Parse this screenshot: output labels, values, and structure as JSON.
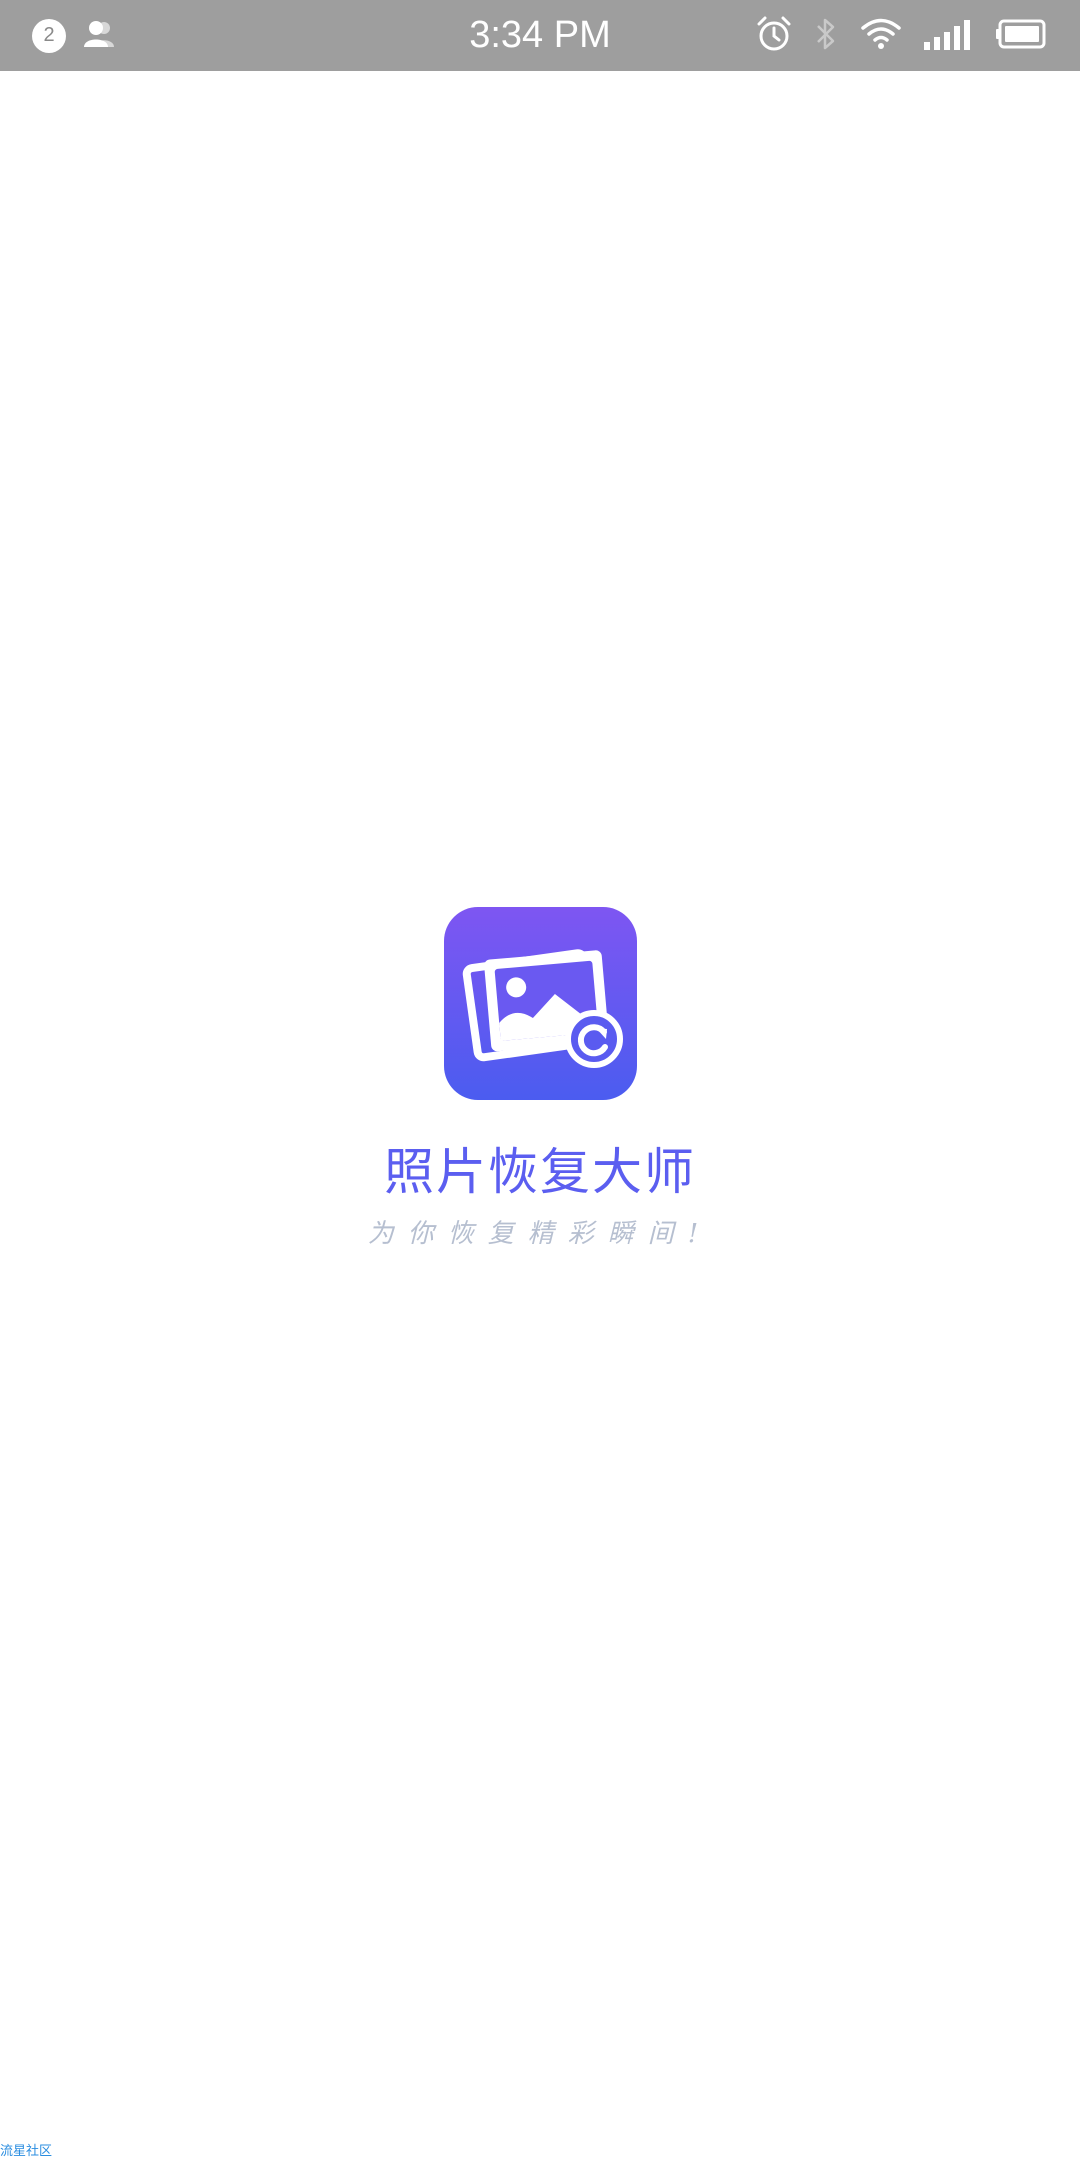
{
  "status_bar": {
    "notification_count": "2",
    "time": "3:34 PM",
    "icons": [
      "contacts-icon",
      "alarm-icon",
      "bluetooth-icon",
      "wifi-icon",
      "signal-icon",
      "battery-icon"
    ]
  },
  "splash": {
    "app_name": "照片恢复大师",
    "slogan": "为你恢复精彩瞬间!",
    "icon": "photo-restore-app-icon"
  },
  "watermark": {
    "text": "流星社区"
  },
  "colors": {
    "status_bar_bg": "#9e9e9e",
    "icon_gradient_top": "#7e56f2",
    "icon_gradient_bottom": "#4b5cf0",
    "app_name": "#5b5ef0",
    "slogan": "#b6bfd0",
    "watermark": "#2a8de0"
  }
}
